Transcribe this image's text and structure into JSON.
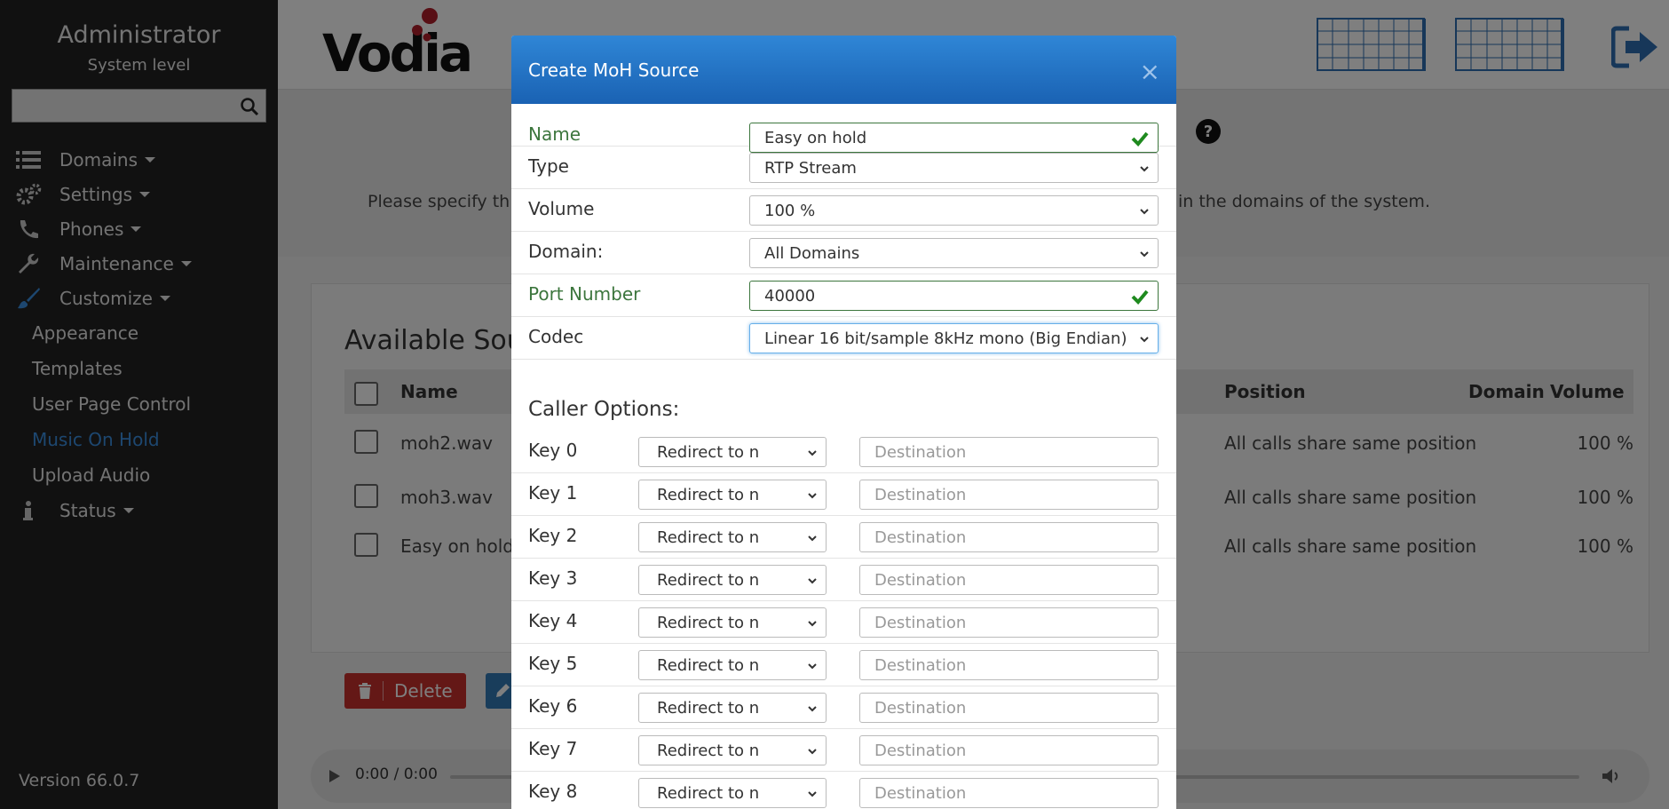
{
  "sidebar": {
    "title": "Administrator",
    "subtitle": "System level",
    "search_placeholder": "",
    "nav": [
      {
        "label": "Domains",
        "icon": "list-icon"
      },
      {
        "label": "Settings",
        "icon": "gears-icon"
      },
      {
        "label": "Phones",
        "icon": "phone-icon"
      },
      {
        "label": "Maintenance",
        "icon": "wrench-icon"
      },
      {
        "label": "Customize",
        "icon": "brush-icon"
      }
    ],
    "customize_items": [
      "Appearance",
      "Templates",
      "User Page Control",
      "Music On Hold",
      "Upload Audio"
    ],
    "active_item": "Music On Hold",
    "status_label": "Status",
    "version": "Version 66.0.7"
  },
  "header": {
    "logo_text": "Vodia"
  },
  "page": {
    "info_text_left": "Please specify th",
    "info_text_right": "in the domains of the system.",
    "panel_title": "Available Sour",
    "columns": {
      "name": "Name",
      "position": "Position",
      "domain": "Domain",
      "volume": "Volume"
    },
    "rows": [
      {
        "name": "moh2.wav",
        "position": "All calls share same position",
        "volume": "100 %"
      },
      {
        "name": "moh3.wav",
        "position": "All calls share same position",
        "volume": "100 %"
      },
      {
        "name": "Easy on hold",
        "position": "All calls share same position",
        "volume": "100 %"
      }
    ],
    "delete_label": "Delete",
    "player_time": "0:00 / 0:00"
  },
  "modal": {
    "title": "Create MoH Source",
    "close": "×",
    "fields": {
      "name": {
        "label": "Name",
        "value": "Easy on hold"
      },
      "type": {
        "label": "Type",
        "value": "RTP Stream"
      },
      "volume": {
        "label": "Volume",
        "value": "100 %"
      },
      "domain": {
        "label": "Domain:",
        "value": "All Domains"
      },
      "port": {
        "label": "Port Number",
        "value": "40000"
      },
      "codec": {
        "label": "Codec",
        "value": "Linear 16 bit/sample 8kHz mono (Big Endian)"
      }
    },
    "caller_options_title": "Caller Options:",
    "keys": [
      {
        "label": "Key 0",
        "action": "Redirect to number",
        "placeholder": "Destination"
      },
      {
        "label": "Key 1",
        "action": "Redirect to number",
        "placeholder": "Destination"
      },
      {
        "label": "Key 2",
        "action": "Redirect to number",
        "placeholder": "Destination"
      },
      {
        "label": "Key 3",
        "action": "Redirect to number",
        "placeholder": "Destination"
      },
      {
        "label": "Key 4",
        "action": "Redirect to number",
        "placeholder": "Destination"
      },
      {
        "label": "Key 5",
        "action": "Redirect to number",
        "placeholder": "Destination"
      },
      {
        "label": "Key 6",
        "action": "Redirect to number",
        "placeholder": "Destination"
      },
      {
        "label": "Key 7",
        "action": "Redirect to number",
        "placeholder": "Destination"
      },
      {
        "label": "Key 8",
        "action": "Redirect to number",
        "placeholder": "Destination"
      }
    ]
  },
  "colors": {
    "sidebar_bg": "#232323",
    "active_link": "#3a8fe0",
    "modal_header": "#2f86d6",
    "valid_green": "#3c763d",
    "delete_red": "#c9302c"
  }
}
